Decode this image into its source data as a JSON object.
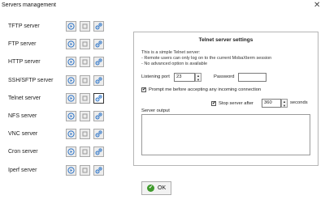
{
  "window": {
    "title": "Servers management",
    "close_glyph": "✕"
  },
  "servers": [
    {
      "name": "TFTP server",
      "active_button": ""
    },
    {
      "name": "FTP server",
      "active_button": ""
    },
    {
      "name": "HTTP server",
      "active_button": ""
    },
    {
      "name": "SSH/SFTP server",
      "active_button": ""
    },
    {
      "name": "Telnet server",
      "active_button": "settings"
    },
    {
      "name": "NFS server",
      "active_button": ""
    },
    {
      "name": "VNC server",
      "active_button": ""
    },
    {
      "name": "Cron server",
      "active_button": ""
    },
    {
      "name": "Iperf server",
      "active_button": ""
    }
  ],
  "server_buttons": {
    "start_icon": "play-icon",
    "stop_icon": "stop-icon",
    "settings_icon": "settings-gears-icon"
  },
  "colors": {
    "start": "#2a73c8",
    "stop": "#9a9a9a",
    "settings": "#2a73c8",
    "ok": "#3f9a2c"
  },
  "panel": {
    "title": "Telnet server settings",
    "info_lines": [
      "This is a simple Telnet server:",
      "- Remote users can only log on to the current MobaXterm session",
      "- No advanced option is available"
    ],
    "listening_port_label": "Listening port",
    "listening_port_value": "23",
    "password_label": "Password",
    "password_value": "",
    "prompt_label": "Prompt me before accepting any incoming connection",
    "prompt_checked": "✔",
    "stop_label": "Stop server after",
    "stop_checked": "✔",
    "stop_value": "360",
    "stop_unit": "seconds",
    "output_label": "Server output",
    "output_text": ""
  },
  "ok_button": {
    "label": "OK",
    "icon_glyph": "✔"
  }
}
